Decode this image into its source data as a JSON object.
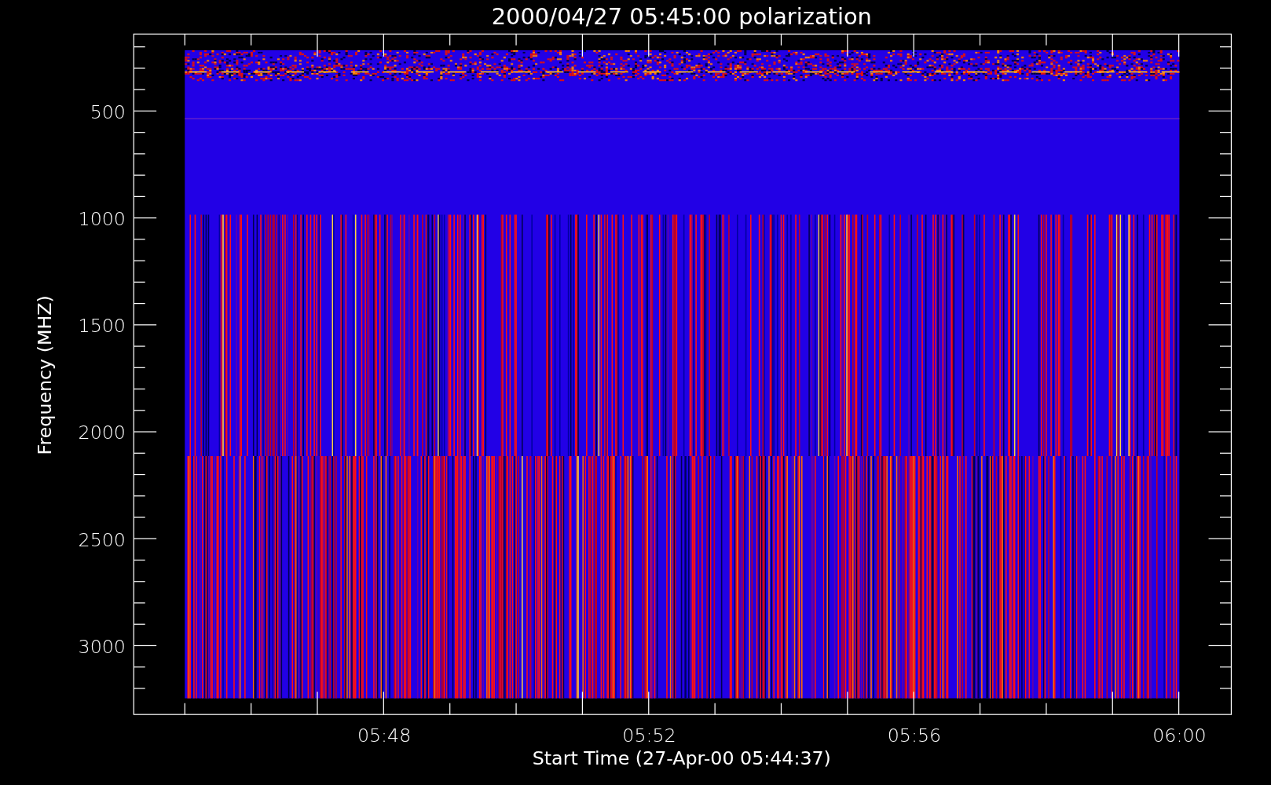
{
  "title": "2000/04/27 05:45:00 polarization",
  "y_axis": {
    "label": "Frequency (MHZ)",
    "ticks": [
      "500",
      "1000",
      "1500",
      "2000",
      "2500",
      "3000"
    ]
  },
  "x_axis": {
    "label": "Start Time (27-Apr-00 05:44:37)",
    "ticks": [
      "05:48",
      "05:52",
      "05:56",
      "06:00"
    ]
  }
}
